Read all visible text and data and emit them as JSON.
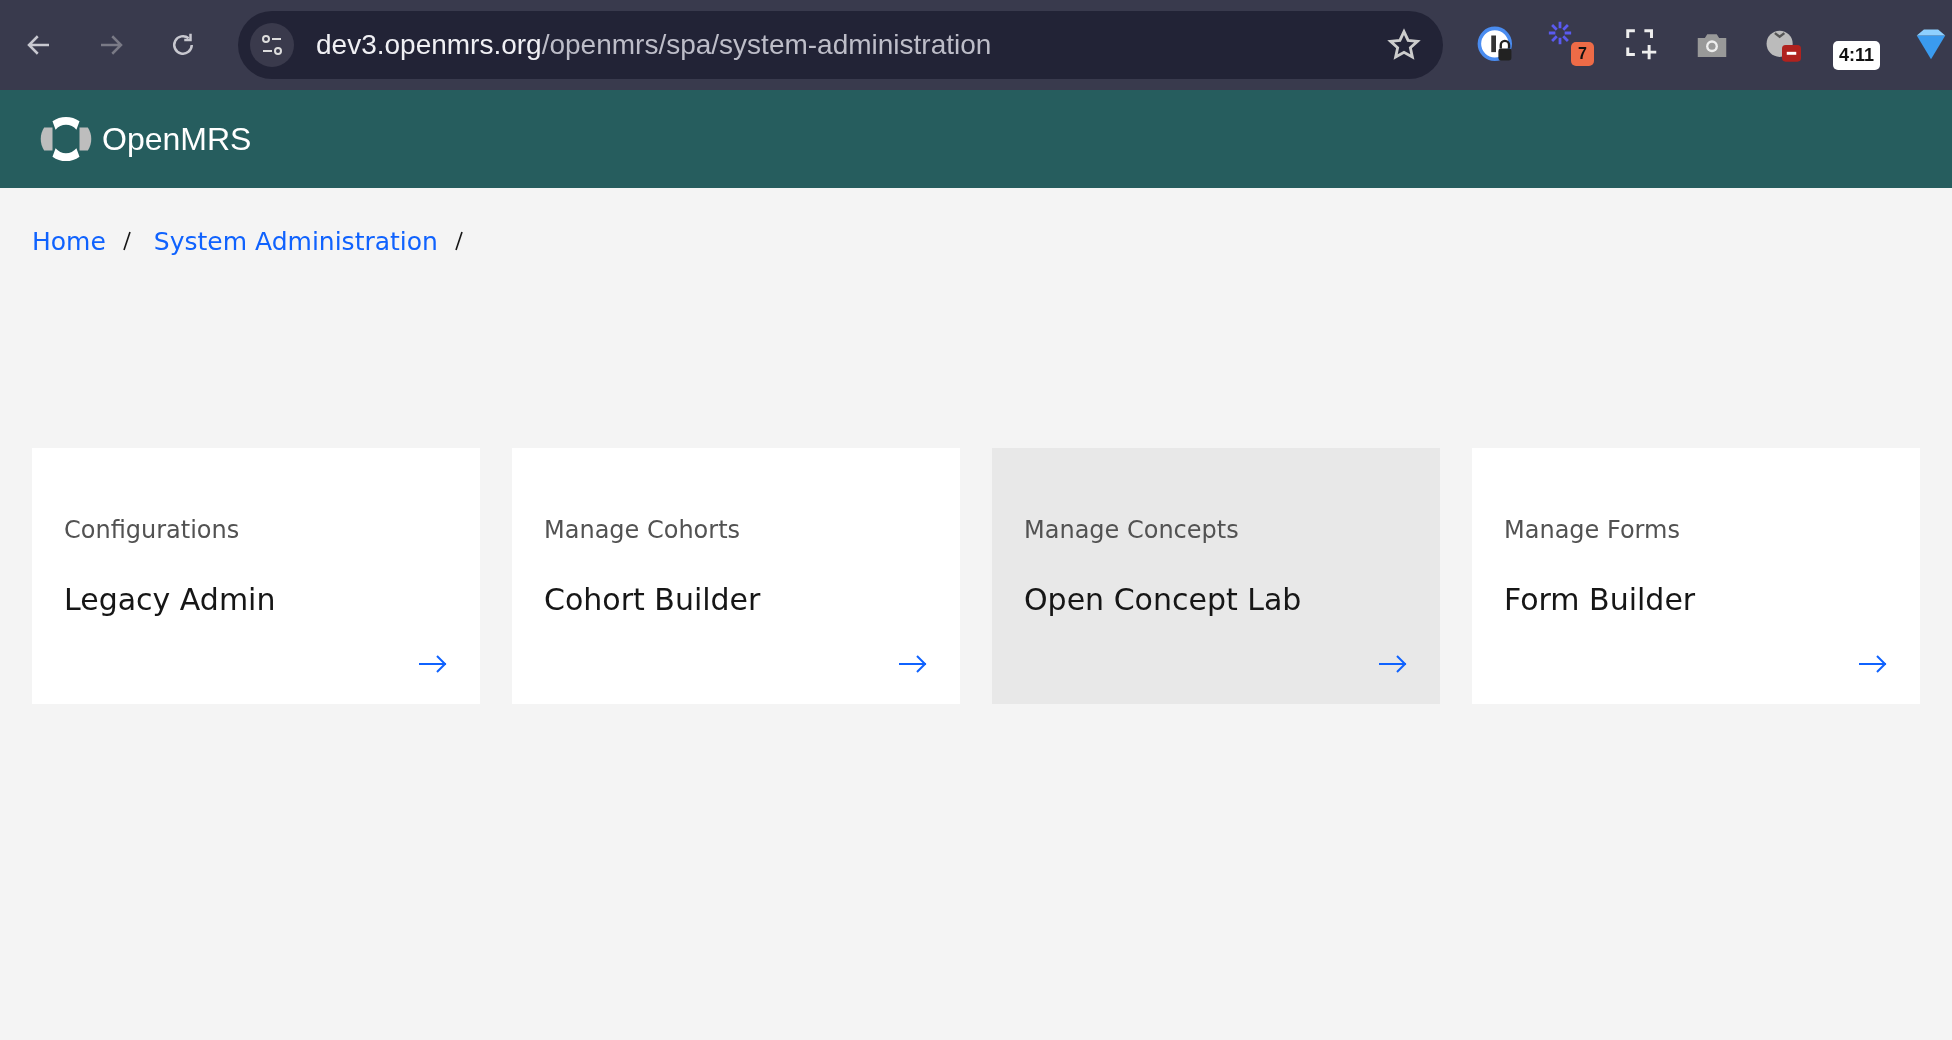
{
  "browser": {
    "url_host": "dev3.openmrs.org",
    "url_path": "/openmrs/spa/system-administration",
    "extensions": [
      {
        "kind": "password"
      },
      {
        "kind": "spinner",
        "badge": "7"
      },
      {
        "kind": "capture"
      },
      {
        "kind": "camera"
      },
      {
        "kind": "tomato"
      },
      {
        "kind": "timer",
        "badge": "4:11"
      },
      {
        "kind": "gem"
      }
    ]
  },
  "header": {
    "logo_text": "OpenMRS"
  },
  "breadcrumbs": [
    "Home",
    "System Administration"
  ],
  "cards": [
    {
      "label": "Configurations",
      "title": "Legacy Admin",
      "hovered": false
    },
    {
      "label": "Manage Cohorts",
      "title": "Cohort Builder",
      "hovered": false
    },
    {
      "label": "Manage Concepts",
      "title": "Open Concept Lab",
      "hovered": true
    },
    {
      "label": "Manage Forms",
      "title": "Form Builder",
      "hovered": false
    }
  ]
}
